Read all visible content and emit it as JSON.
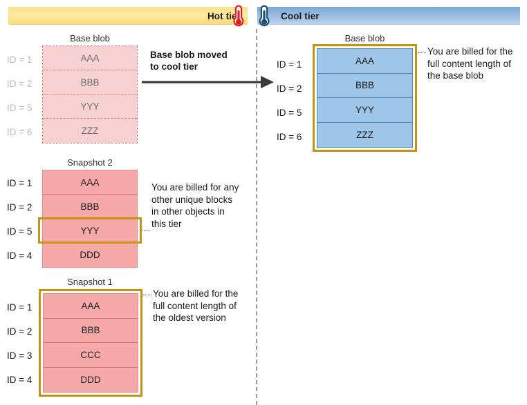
{
  "tiers": {
    "hot": {
      "label": "Hot tier",
      "icon": "thermometer-hot-icon",
      "color": "#fae188"
    },
    "cool": {
      "label": "Cool tier",
      "icon": "thermometer-cool-icon",
      "color": "#9fc0e3"
    }
  },
  "transition": {
    "label_line1": "Base blob moved",
    "label_line2": "to cool tier",
    "icon": "right-arrow-icon"
  },
  "hot_tier": {
    "base_blob": {
      "title": "Base blob",
      "state": "moved-away",
      "rows": [
        {
          "id": "ID = 1",
          "block": "AAA"
        },
        {
          "id": "ID = 2",
          "block": "BBB"
        },
        {
          "id": "ID = 5",
          "block": "YYY"
        },
        {
          "id": "ID = 6",
          "block": "ZZZ"
        }
      ]
    },
    "snapshot2": {
      "title": "Snapshot 2",
      "rows": [
        {
          "id": "ID = 1",
          "block": "AAA",
          "highlighted": false
        },
        {
          "id": "ID = 2",
          "block": "BBB",
          "highlighted": false
        },
        {
          "id": "ID = 5",
          "block": "YYY",
          "highlighted": true
        },
        {
          "id": "ID = 4",
          "block": "DDD",
          "highlighted": false
        }
      ],
      "callout": "You are billed for any other unique blocks in other objects in this tier"
    },
    "snapshot1": {
      "title": "Snapshot 1",
      "highlighted": true,
      "rows": [
        {
          "id": "ID = 1",
          "block": "AAA"
        },
        {
          "id": "ID = 2",
          "block": "BBB"
        },
        {
          "id": "ID = 3",
          "block": "CCC"
        },
        {
          "id": "ID = 4",
          "block": "DDD"
        }
      ],
      "callout": "You are billed for the full content length of the oldest version"
    }
  },
  "cool_tier": {
    "base_blob": {
      "title": "Base blob",
      "highlighted": true,
      "rows": [
        {
          "id": "ID = 1",
          "block": "AAA"
        },
        {
          "id": "ID = 2",
          "block": "BBB"
        },
        {
          "id": "ID = 5",
          "block": "YYY"
        },
        {
          "id": "ID = 6",
          "block": "ZZZ"
        }
      ],
      "callout": "You are billed for the full content length of the base blob"
    }
  }
}
